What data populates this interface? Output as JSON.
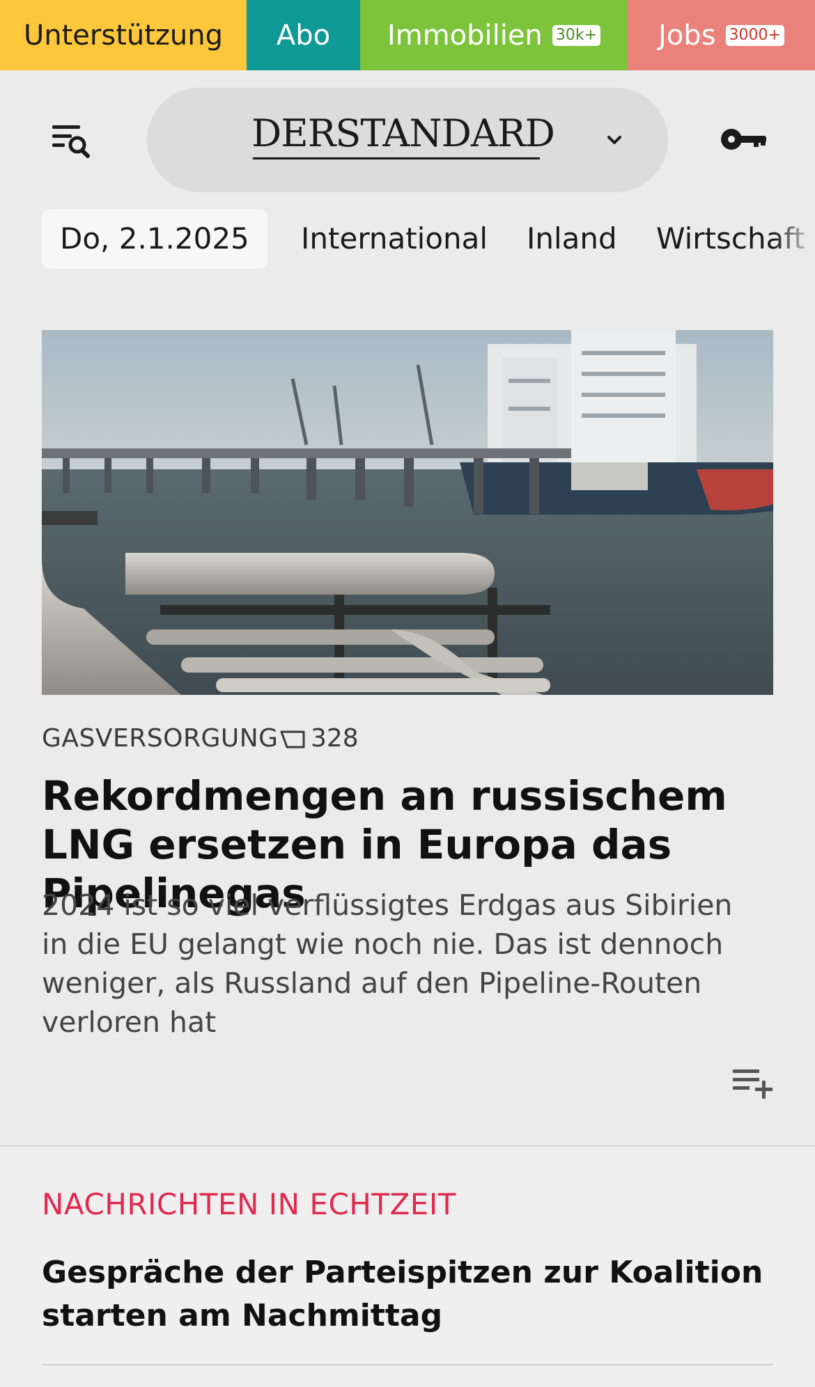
{
  "topbar": {
    "support": "Unterstützung",
    "abo": "Abo",
    "immobilien": "Immobilien",
    "immobilien_badge": "30k+",
    "jobs": "Jobs",
    "jobs_badge": "3000+"
  },
  "header": {
    "logo": "DERSTANDARD",
    "menu_icon": "menu-search-icon",
    "login_icon": "key-icon"
  },
  "nav": {
    "date": "Do, 2.1.2025",
    "items": [
      "International",
      "Inland",
      "Wirtschaft"
    ]
  },
  "article": {
    "kicker": "GASVERSORGUNG",
    "comment_count": "328",
    "headline": "Rekordmengen an russischem LNG ersetzen in Europa das Pipelinegas",
    "teaser": "2024 ist so viel verflüssigtes Erdgas aus Sibirien in die EU gelangt wie noch nie. Das ist dennoch weniger, als Russland auf den Pipeline-Routen verloren hat"
  },
  "live": {
    "title": "NACHRICHTEN IN ECHTZEIT",
    "headline": "Gespräche der Parteispitzen zur Koalition starten am Nachmittag"
  },
  "colors": {
    "support": "#fcc73a",
    "abo": "#0f9a96",
    "immobilien": "#7dc43c",
    "jobs": "#ea827b",
    "live_accent": "#e0294e"
  }
}
